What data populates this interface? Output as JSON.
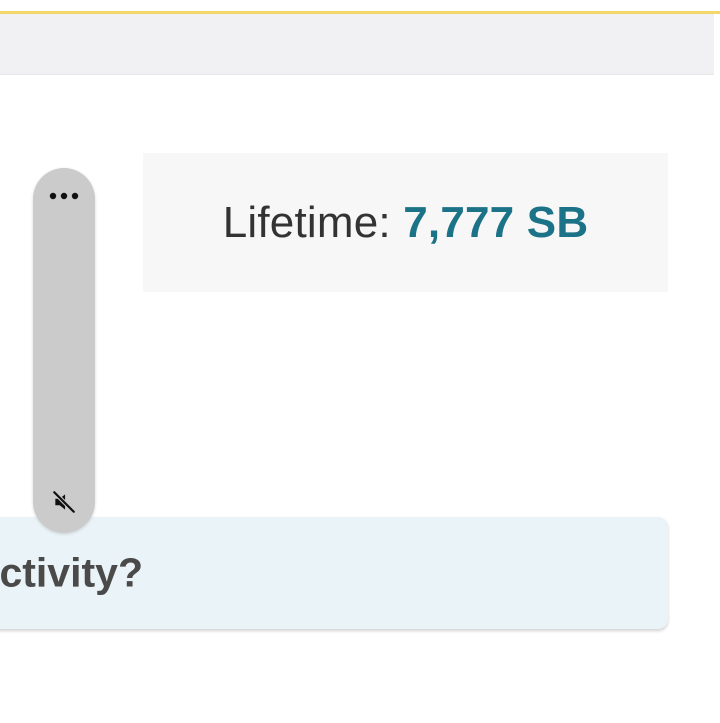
{
  "lifetime": {
    "label": "Lifetime:",
    "value": "7,777 SB"
  },
  "question": {
    "text": "ctivity?"
  },
  "floating_panel": {
    "top_icon": "more-horizontal-icon",
    "bottom_icon": "volume-muted-icon"
  },
  "colors": {
    "accent": "#1c7387",
    "top_border": "#f2d76a",
    "question_bg": "#eaf3f7"
  }
}
